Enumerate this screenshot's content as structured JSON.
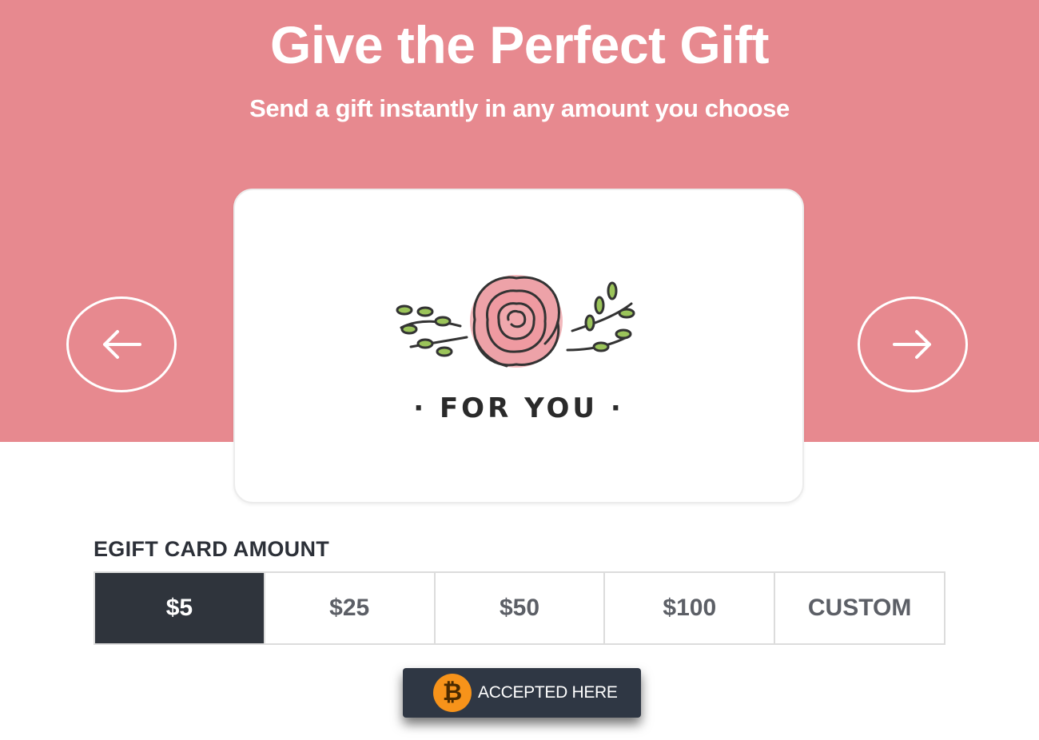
{
  "hero": {
    "title": "Give the Perfect Gift",
    "subtitle": "Send a gift instantly in any amount you choose",
    "background_color": "#e7898f"
  },
  "carousel": {
    "prev_icon": "arrow-left-icon",
    "next_icon": "arrow-right-icon",
    "card": {
      "illustration": "rose-flower-icon",
      "text": "· FOR YOU ·"
    }
  },
  "amount": {
    "label": "EGIFT CARD AMOUNT",
    "options": [
      "$5",
      "$25",
      "$50",
      "$100",
      "CUSTOM"
    ],
    "selected": "$5",
    "selected_color": "#2f343c"
  },
  "badge": {
    "icon": "bitcoin-icon",
    "symbol": "₿",
    "text": "ACCEPTED HERE",
    "coin_color": "#f7931a"
  }
}
